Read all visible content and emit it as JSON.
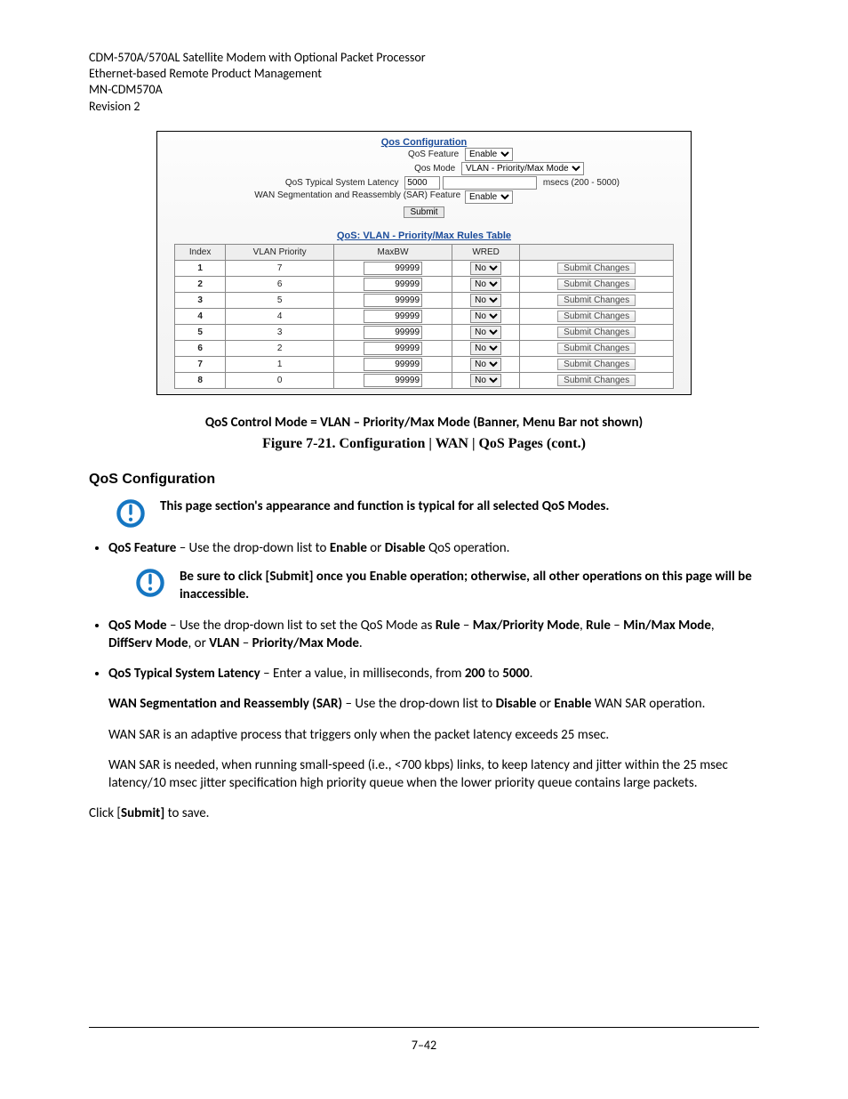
{
  "header": {
    "left1": "CDM-570A/570AL Satellite Modem with Optional Packet Processor",
    "left2": "Ethernet-based Remote Product Management",
    "right1": "MN-CDM570A",
    "right2": "Revision 2"
  },
  "footer": {
    "page": "7–42"
  },
  "figure": {
    "title": "Qos Configuration",
    "lines": {
      "feature_label": "QoS Feature",
      "feature_value": "Enable",
      "mode_label": "Qos Mode",
      "mode_value": "VLAN - Priority/Max Mode",
      "latency_label": "QoS Typical System Latency",
      "latency_value": "5000",
      "latency_after": "msecs (200 - 5000)",
      "sar_label": "WAN Segmentation and Reassembly (SAR) Feature",
      "sar_value": "Enable",
      "submit": "Submit"
    },
    "rules_title": "QoS: VLAN - Priority/Max Rules Table",
    "rules_headers": [
      "Index",
      "VLAN Priority",
      "MaxBW",
      "WRED",
      ""
    ],
    "rule_btn": "Submit Changes",
    "rules": [
      {
        "idx": "1",
        "prio": "7",
        "maxbw": "99999",
        "wred": "No"
      },
      {
        "idx": "2",
        "prio": "6",
        "maxbw": "99999",
        "wred": "No"
      },
      {
        "idx": "3",
        "prio": "5",
        "maxbw": "99999",
        "wred": "No"
      },
      {
        "idx": "4",
        "prio": "4",
        "maxbw": "99999",
        "wred": "No"
      },
      {
        "idx": "5",
        "prio": "3",
        "maxbw": "99999",
        "wred": "No"
      },
      {
        "idx": "6",
        "prio": "2",
        "maxbw": "99999",
        "wred": "No"
      },
      {
        "idx": "7",
        "prio": "1",
        "maxbw": "99999",
        "wred": "No"
      },
      {
        "idx": "8",
        "prio": "0",
        "maxbw": "99999",
        "wred": "No"
      }
    ]
  },
  "body": {
    "caption_line1_pre": "QoS Control Mode = VLAN",
    "caption_line1_sep": " – ",
    "caption_line1_post": "Priority/Max Mode (Banner, Menu Bar not shown)",
    "fig_caption": "Figure 7-21. Configuration | WAN | QoS Pages (cont.)",
    "section": "QoS Configuration",
    "note1": "This page section's appearance and function is typical for all selected QoS Modes.",
    "bullet1_lead": "QoS Feature",
    "bullet1_rest": " – Use the drop-down list to ",
    "bullet1_enable": "Enable",
    "bullet1_or": " or ",
    "bullet1_disable": "Disable",
    "bullet1_tail": " QoS operation.",
    "note2": "Be sure to click [Submit] once you Enable operation; otherwise, all other operations on this page will be inaccessible.",
    "bullet2_lead": "QoS Mode",
    "bullet2_rest": " – Use the drop-down list to set the QoS Mode as ",
    "bullet2_rule": "Rule",
    "bullet2_dash": " – ",
    "bullet2_maxpri": "Max/Priority Mode",
    "bullet2_comma": ", ",
    "bullet2_minmax": "Min/Max Mode",
    "bullet2_comma2": ", ",
    "bullet2_diffserv": "DiffServ Mode",
    "bullet2_or": ", or ",
    "bullet2_vlan": "VLAN",
    "bullet2_dash2": " – ",
    "bullet2_primax": "Priority/Max Mode",
    "bullet2_period": ".",
    "bullet3_lead": "QoS Typical System Latency",
    "bullet3_rest": " – Enter a value, in milliseconds, from ",
    "bullet3_200": "200",
    "bullet3_to": " to ",
    "bullet3_5000": "5000",
    "bullet3_period": ".",
    "para_sar_lead": "WAN Segmentation and Reassembly (SAR)",
    "para_sar_rest": " – Use the drop-down list to ",
    "para_sar_disable": "Disable",
    "para_sar_or": " or ",
    "para_sar_enable": "Enable",
    "para_sar_tail": " WAN SAR operation.",
    "para_wan1": "WAN SAR is an adaptive process that triggers only when the packet latency exceeds 25 msec.",
    "para_wan2": "WAN SAR is needed, when running small-speed (i.e., <700 kbps) links, to keep latency and jitter within the 25 msec latency/10 msec jitter specification high priority queue when the lower priority queue contains large packets.",
    "click_submit_pre": "Click [",
    "click_submit_bold": "Submit]",
    "click_submit_post": " to save."
  }
}
